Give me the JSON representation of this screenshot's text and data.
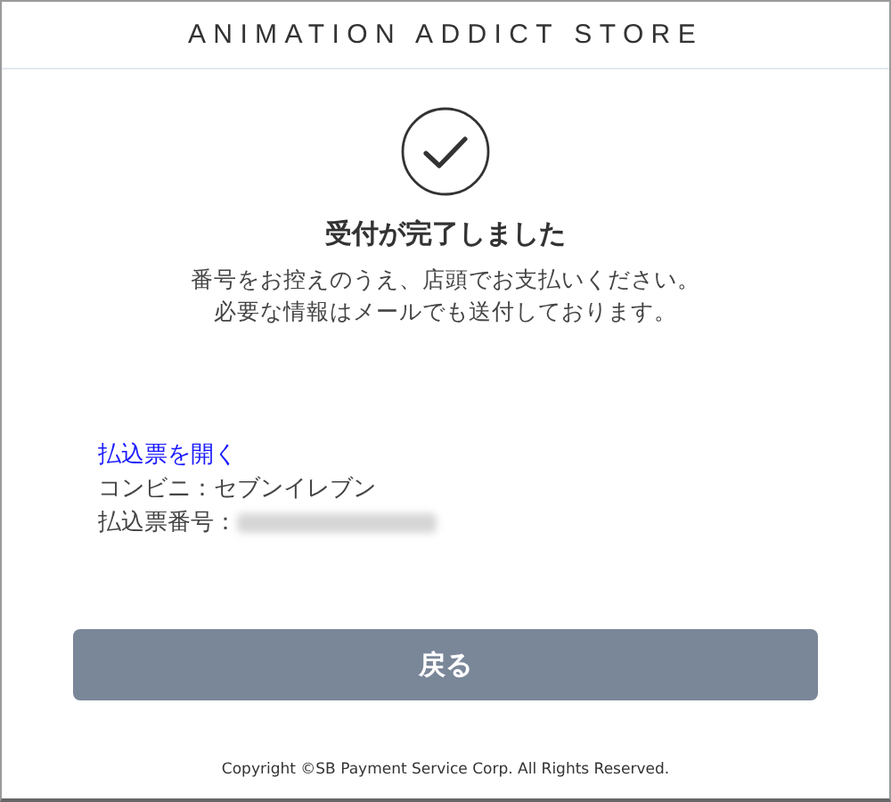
{
  "header": {
    "title": "ANIMATION ADDICT STORE"
  },
  "completion": {
    "title": "受付が完了しました",
    "message_lines": [
      "番号をお控えのうえ、店頭でお支払いください。",
      "必要な情報はメールでも送付しております。"
    ]
  },
  "payment_info": {
    "link": "払込票を開く",
    "store": "コンビニ：セブンイレブン",
    "number_label": "払込票番号："
  },
  "back_button": {
    "label": "戻る"
  },
  "footer": {
    "copyright": "Copyright ©SB Payment Service Corp. All Rights Reserved."
  }
}
